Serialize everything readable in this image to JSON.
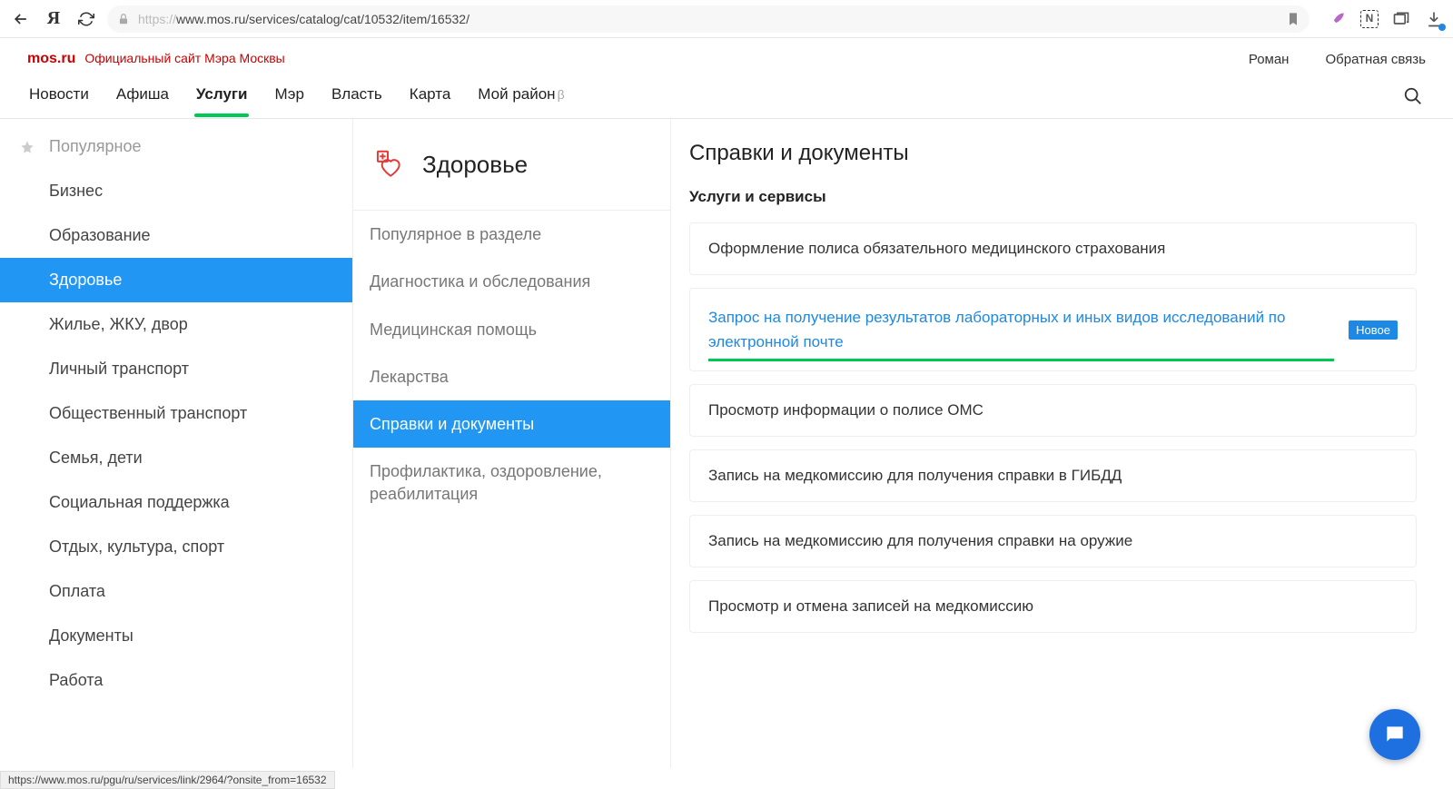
{
  "browser": {
    "url_proto": "https://",
    "url_rest": "www.mos.ru/services/catalog/cat/10532/item/16532/"
  },
  "header": {
    "logo": "mos.ru",
    "tagline": "Официальный сайт Мэра Москвы",
    "user": "Роман",
    "feedback": "Обратная связь"
  },
  "nav": {
    "items": [
      {
        "label": "Новости"
      },
      {
        "label": "Афиша"
      },
      {
        "label": "Услуги",
        "active": true
      },
      {
        "label": "Мэр"
      },
      {
        "label": "Власть"
      },
      {
        "label": "Карта"
      },
      {
        "label": "Мой район",
        "beta": "β"
      }
    ]
  },
  "sidebar": {
    "items": [
      {
        "label": "Популярное",
        "star": true
      },
      {
        "label": "Бизнес"
      },
      {
        "label": "Образование"
      },
      {
        "label": "Здоровье",
        "active": true
      },
      {
        "label": "Жилье, ЖКУ, двор"
      },
      {
        "label": "Личный транспорт"
      },
      {
        "label": "Общественный транспорт"
      },
      {
        "label": "Семья, дети"
      },
      {
        "label": "Социальная поддержка"
      },
      {
        "label": "Отдых, культура, спорт"
      },
      {
        "label": "Оплата"
      },
      {
        "label": "Документы"
      },
      {
        "label": "Работа"
      }
    ]
  },
  "category": {
    "title": "Здоровье",
    "subs": [
      {
        "label": "Популярное в разделе"
      },
      {
        "label": "Диагностика и обследования"
      },
      {
        "label": "Медицинская помощь"
      },
      {
        "label": "Лекарства"
      },
      {
        "label": "Справки и документы",
        "active": true
      },
      {
        "label": "Профилактика, оздоровление, реабилитация"
      }
    ]
  },
  "content": {
    "heading": "Справки и документы",
    "subtitle": "Услуги и сервисы",
    "badge_new": "Новое",
    "services": [
      {
        "label": "Оформление полиса обязательного медицинского страхования"
      },
      {
        "label": "Запрос на получение результатов лабораторных и иных видов исследований по электронной почте",
        "highlight": true,
        "new": true
      },
      {
        "label": "Просмотр информации о полисе ОМС"
      },
      {
        "label": "Запись на медкомиссию для получения справки в ГИБДД"
      },
      {
        "label": "Запись на медкомиссию для получения справки на оружие"
      },
      {
        "label": "Просмотр и отмена записей на медкомиссию"
      }
    ]
  },
  "status_bar": "https://www.mos.ru/pgu/ru/services/link/2964/?onsite_from=16532"
}
